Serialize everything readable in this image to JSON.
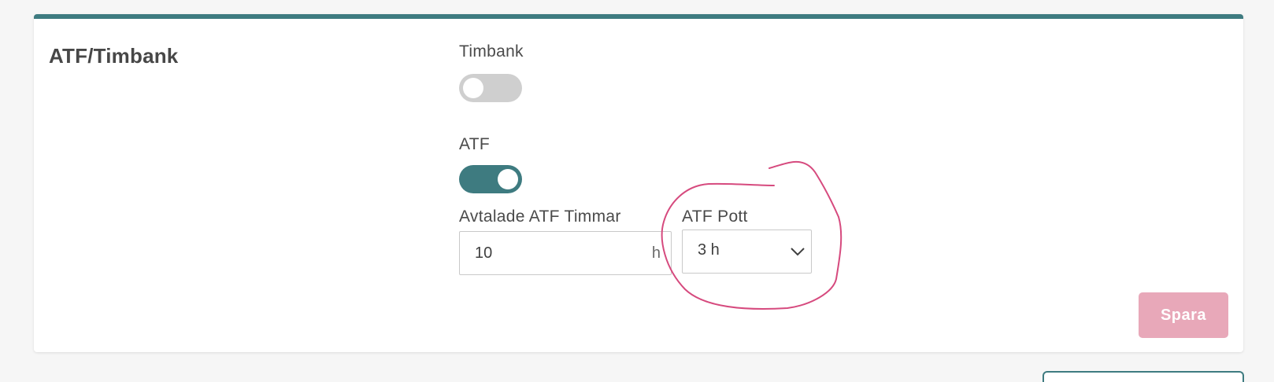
{
  "section": {
    "title": "ATF/Timbank"
  },
  "timbank": {
    "label": "Timbank",
    "enabled": false
  },
  "atf": {
    "label": "ATF",
    "enabled": true
  },
  "agreed_hours": {
    "label": "Avtalade ATF Timmar",
    "value": "10",
    "unit": "h"
  },
  "atf_pot": {
    "label": "ATF Pott",
    "selected": "3 h"
  },
  "actions": {
    "save_label": "Spara"
  },
  "colors": {
    "accent": "#3e7b80",
    "save_disabled": "#e8a8b9",
    "annotation": "#d64a7e"
  }
}
